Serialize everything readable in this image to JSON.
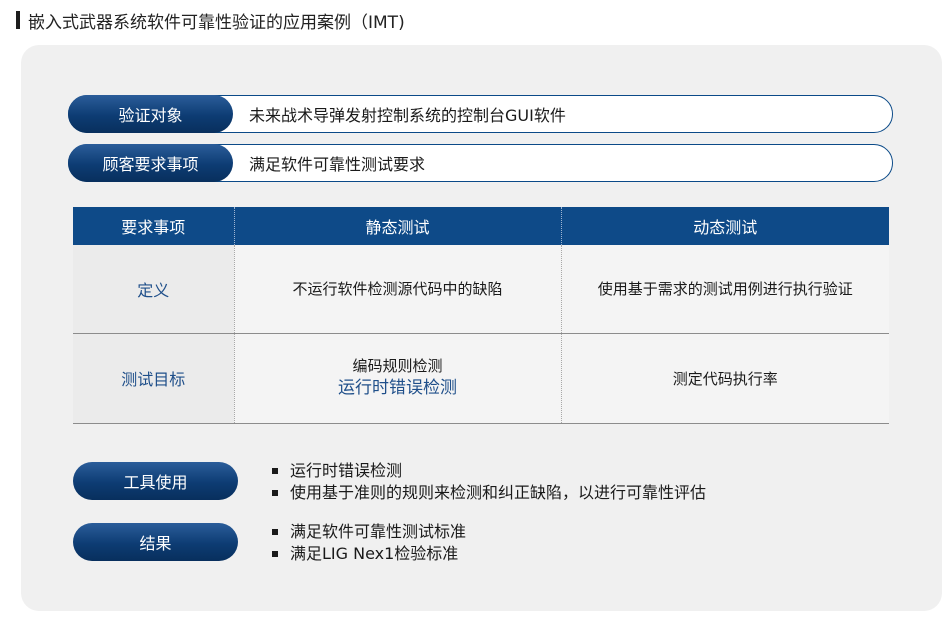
{
  "page_title": "嵌入式武器系统软件可靠性验证的应用案例（IMT)",
  "info_rows": [
    {
      "label": "验证对象",
      "value": "未来战术导弹发射控制系统的控制台GUI软件"
    },
    {
      "label": "顾客要求事项",
      "value": "满足软件可靠性测试要求"
    }
  ],
  "table": {
    "headers": [
      "要求事项",
      "静态测试",
      "动态测试"
    ],
    "rows": [
      {
        "label": "定义",
        "static": "不运行软件检测源代码中的缺陷",
        "dynamic": "使用基于需求的测试用例进行执行验证"
      },
      {
        "label": "测试目标",
        "static_line1": "编码规则检测",
        "static_line2": "运行时错误检测",
        "dynamic": "测定代码执行率"
      }
    ]
  },
  "tools": {
    "label": "工具使用",
    "items": [
      "运行时错误检测",
      "使用基于准则的规则来检测和纠正缺陷，以进行可靠性评估"
    ]
  },
  "results": {
    "label": "结果",
    "items": [
      "满足软件可靠性测试标准",
      "满足LIG Nex1检验标准"
    ]
  }
}
